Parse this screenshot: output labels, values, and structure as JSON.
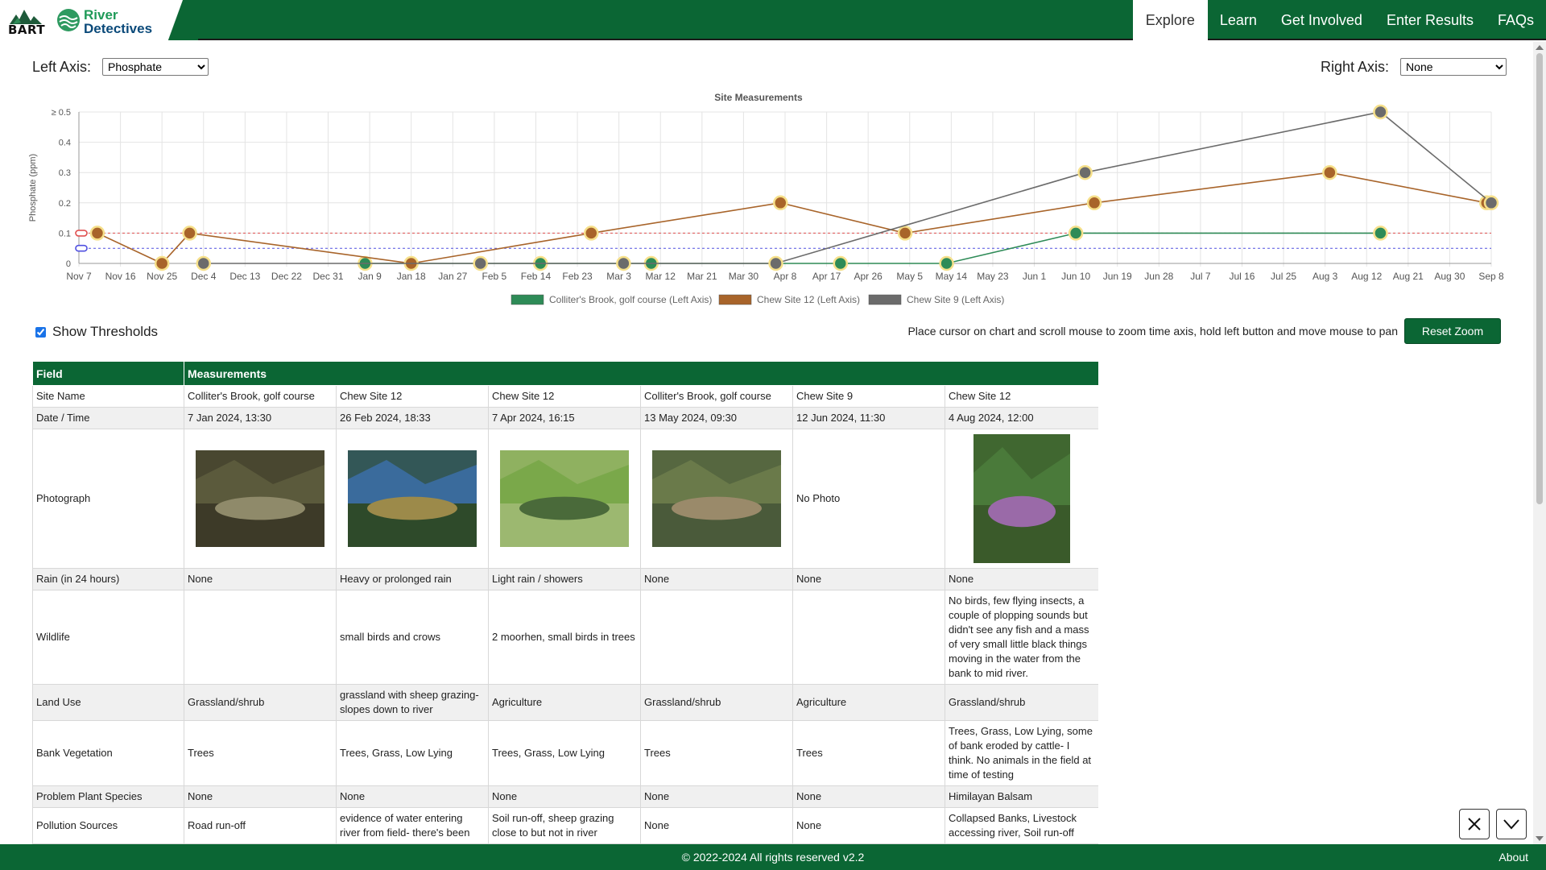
{
  "brand": {
    "bart": "BART",
    "title_line1": "River",
    "title_line2": "Detectives"
  },
  "nav": [
    {
      "label": "Explore",
      "active": true
    },
    {
      "label": "Learn"
    },
    {
      "label": "Get Involved"
    },
    {
      "label": "Enter Results"
    },
    {
      "label": "FAQs"
    }
  ],
  "controls": {
    "left_axis_label": "Left Axis:",
    "left_axis_value": "Phosphate",
    "right_axis_label": "Right Axis:",
    "right_axis_value": "None",
    "show_thresholds_label": "Show Thresholds",
    "show_thresholds_checked": true,
    "zoom_hint": "Place cursor on chart and scroll mouse to zoom time axis, hold left button and move mouse to pan",
    "reset_zoom_label": "Reset Zoom"
  },
  "chart_data": {
    "type": "line",
    "title": "Site Measurements",
    "ylabel": "Phosphate (ppm)",
    "xlabel": "",
    "ylim": [
      0,
      0.5
    ],
    "y_ticks": [
      "0",
      "0.1",
      "0.2",
      "0.3",
      "0.4",
      "≥ 0.5"
    ],
    "x_ticks": [
      "Nov 7",
      "Nov 16",
      "Nov 25",
      "Dec 4",
      "Dec 13",
      "Dec 22",
      "Dec 31",
      "Jan 9",
      "Jan 18",
      "Jan 27",
      "Feb 5",
      "Feb 14",
      "Feb 23",
      "Mar 3",
      "Mar 12",
      "Mar 21",
      "Mar 30",
      "Apr 8",
      "Apr 17",
      "Apr 26",
      "May 5",
      "May 14",
      "May 23",
      "Jun 1",
      "Jun 10",
      "Jun 19",
      "Jun 28",
      "Jul 7",
      "Jul 16",
      "Jul 25",
      "Aug 3",
      "Aug 12",
      "Aug 21",
      "Aug 30",
      "Sep 8"
    ],
    "thresholds": [
      {
        "value": 0.1,
        "color": "#e05050"
      },
      {
        "value": 0.05,
        "color": "#5050e0"
      }
    ],
    "series": [
      {
        "name": "Colliter's Brook, golf course (Left Axis)",
        "color": "#2e8b57",
        "points": [
          [
            "Jan 8",
            0
          ],
          [
            "Feb 15",
            0
          ],
          [
            "Mar 10",
            0
          ],
          [
            "Apr 20",
            0
          ],
          [
            "May 13",
            0
          ],
          [
            "Jun 10",
            0.1
          ],
          [
            "Aug 15",
            0.1
          ]
        ]
      },
      {
        "name": "Chew Site 12 (Left Axis)",
        "color": "#a8642a",
        "points": [
          [
            "Nov 11",
            0.1
          ],
          [
            "Nov 25",
            0
          ],
          [
            "Dec 1",
            0.1
          ],
          [
            "Jan 18",
            0
          ],
          [
            "Feb 26",
            0.1
          ],
          [
            "Apr 7",
            0.2
          ],
          [
            "May 4",
            0.1
          ],
          [
            "Jun 14",
            0.2
          ],
          [
            "Aug 4",
            0.3
          ],
          [
            "Sep 7",
            0.2
          ]
        ]
      },
      {
        "name": "Chew Site 9 (Left Axis)",
        "color": "#6b6b6b",
        "points": [
          [
            "Dec 4",
            0
          ],
          [
            "Feb 2",
            0
          ],
          [
            "Mar 4",
            0
          ],
          [
            "Apr 6",
            0
          ],
          [
            "Jun 12",
            0.3
          ],
          [
            "Aug 15",
            0.5
          ],
          [
            "Sep 8",
            0.2
          ]
        ]
      }
    ],
    "legend": [
      "Colliter's Brook, golf course (Left Axis)",
      "Chew Site 12 (Left Axis)",
      "Chew Site 9 (Left Axis)"
    ]
  },
  "table": {
    "header_field": "Field",
    "header_measurements": "Measurements",
    "rows": [
      {
        "field": "Site Name",
        "values": [
          "Colliter's Brook, golf course",
          "Chew Site 12",
          "Chew Site 12",
          "Colliter's Brook, golf course",
          "Chew Site 9",
          "Chew Site 12"
        ]
      },
      {
        "field": "Date / Time",
        "values": [
          "7 Jan 2024, 13:30",
          "26 Feb 2024, 18:33",
          "7 Apr 2024, 16:15",
          "13 May 2024, 09:30",
          "12 Jun 2024, 11:30",
          "4 Aug 2024, 12:00"
        ]
      },
      {
        "field": "Photograph",
        "values": [
          "",
          "",
          "",
          "",
          "No Photo",
          ""
        ]
      },
      {
        "field": "Rain (in 24 hours)",
        "values": [
          "None",
          "Heavy or prolonged rain",
          "Light rain / showers",
          "None",
          "None",
          "None"
        ]
      },
      {
        "field": "Wildlife",
        "values": [
          "",
          "small birds and crows",
          "2 moorhen, small birds in trees",
          "",
          "",
          "No birds, few flying insects, a couple of plopping sounds but didn't see any fish and a mass of very small little black things moving in the water from the bank to mid river."
        ]
      },
      {
        "field": "Land Use",
        "values": [
          "Grassland/shrub",
          "grassland with sheep grazing- slopes down to river",
          "Agriculture",
          "Grassland/shrub",
          "Agriculture",
          "Grassland/shrub"
        ]
      },
      {
        "field": "Bank Vegetation",
        "values": [
          "Trees",
          "Trees, Grass, Low Lying",
          "Trees, Grass, Low Lying",
          "Trees",
          "Trees",
          "Trees, Grass, Low Lying, some of bank eroded by cattle- I think. No animals in the field at time of testing"
        ]
      },
      {
        "field": "Problem Plant Species",
        "values": [
          "None",
          "None",
          "None",
          "None",
          "None",
          "Himilayan Balsam"
        ]
      },
      {
        "field": "Pollution Sources",
        "values": [
          "Road run-off",
          "evidence of water entering river from field- there's been",
          "Soil run-off, sheep grazing close to but not in river",
          "None",
          "None",
          "Collapsed Banks, Livestock accessing river, Soil run-off"
        ]
      }
    ]
  },
  "footer": {
    "copyright": "© 2022-2024 All rights reserved v2.2",
    "about": "About"
  },
  "colors": {
    "brand_green": "#0b6634",
    "legend_green": "#2e8b57",
    "legend_brown": "#a8642a",
    "legend_grey": "#6b6b6b"
  }
}
